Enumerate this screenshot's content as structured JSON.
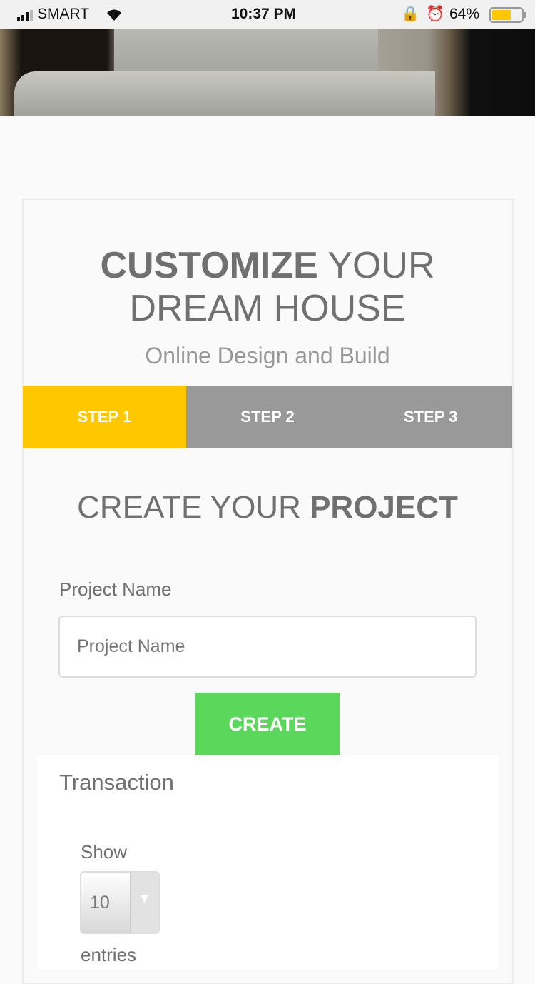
{
  "status_bar": {
    "carrier": "SMART",
    "time": "10:37 PM",
    "battery": "64%",
    "battery_level": 0.64
  },
  "header": {
    "title_bold": "CUSTOMIZE",
    "title_rest": " YOUR",
    "title_line2": "DREAM HOUSE",
    "subtitle": "Online Design and Build"
  },
  "steps": [
    {
      "label": "STEP 1",
      "active": true
    },
    {
      "label": "STEP 2"
    },
    {
      "label": "STEP 3"
    }
  ],
  "colors": {
    "active_step": "#ffc700",
    "create": "#5bd75b"
  },
  "form": {
    "heading_light": "CREATE YOUR ",
    "heading_bold": "PROJECT",
    "label": "Project Name",
    "placeholder": "Project Name",
    "value": "",
    "button": "CREATE"
  },
  "transaction": {
    "title": "Transaction",
    "show": "Show",
    "entries_value": "10",
    "entries": "entries"
  }
}
